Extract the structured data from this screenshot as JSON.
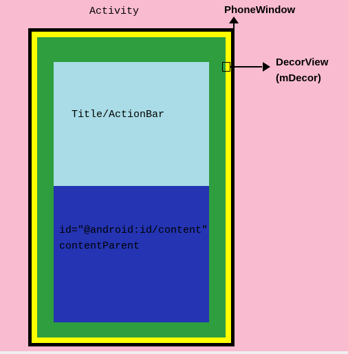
{
  "labels": {
    "activity": "Activity",
    "phoneWindow": "PhoneWindow",
    "decorView": "DecorView",
    "decorViewSub": "(mDecor)",
    "titleBar": "Title/ActionBar",
    "contentId": "id=\"@android:id/content\"",
    "contentParent": "contentParent"
  },
  "colors": {
    "activityBg": "#f9bbd0",
    "phoneWindowBg": "#ffff00",
    "phoneWindowBorder": "#000000",
    "decorViewBg": "#2e9e3f",
    "titleBarBg": "#a9dce6",
    "contentBg": "#2434b3"
  }
}
